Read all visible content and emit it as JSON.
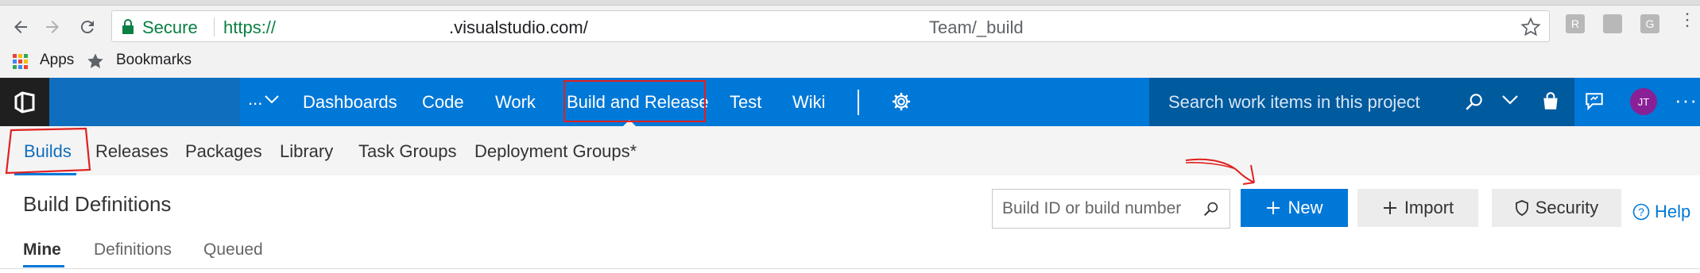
{
  "browser": {
    "secure_label": "Secure",
    "url_scheme": "https://",
    "url_host": ".visualstudio.com/",
    "url_path": "Team/_build",
    "bookmarks": [
      {
        "label": "Apps",
        "icon": "apps-grid-icon"
      },
      {
        "label": "Bookmarks",
        "icon": "star-icon"
      }
    ],
    "extensions": [
      "R",
      "",
      "G"
    ]
  },
  "topbar": {
    "project_picker": "...",
    "nav": [
      "Dashboards",
      "Code",
      "Work",
      "Build and Release",
      "Test",
      "Wiki"
    ],
    "search_placeholder": "Search work items in this project",
    "avatar_initials": "JT",
    "more": "···",
    "colors": {
      "bar": "#0078d7",
      "search": "#005a9e",
      "logo_bg": "#1f1f1f",
      "avatar": "#8a2096"
    }
  },
  "subnav": {
    "tabs": [
      "Builds",
      "Releases",
      "Packages",
      "Library",
      "Task Groups",
      "Deployment Groups*"
    ]
  },
  "content": {
    "title": "Build Definitions",
    "search_placeholder": "Build ID or build number",
    "new_label": "New",
    "import_label": "Import",
    "security_label": "Security",
    "help_label": "Help",
    "pivots": [
      "Mine",
      "Definitions",
      "Queued"
    ]
  }
}
